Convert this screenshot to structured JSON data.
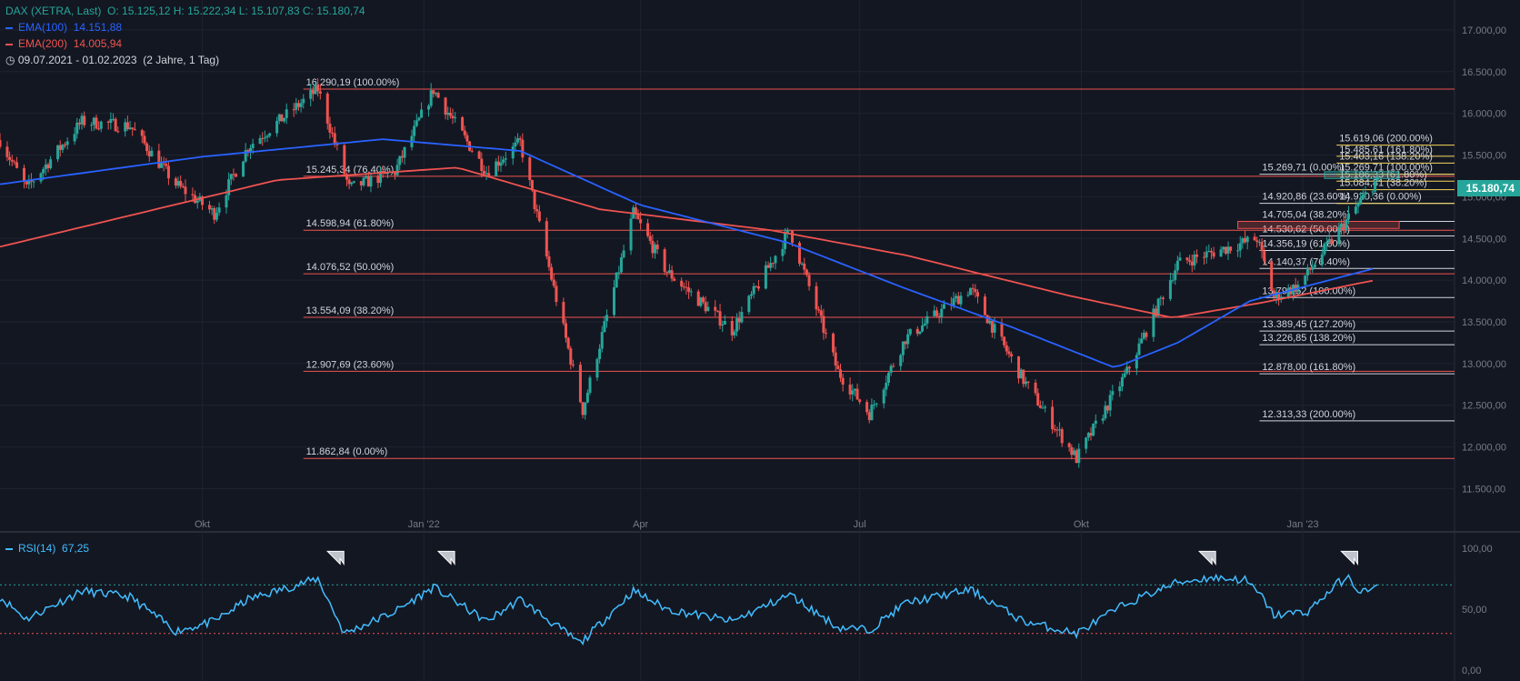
{
  "header": {
    "symbol": "DAX (XETRA, Last)",
    "ohlc": "O: 15.125,12  H: 15.222,34  L: 15.107,83  C: 15.180,74",
    "ema100_label": "EMA(100)",
    "ema100_value": "14.151,88",
    "ema200_label": "EMA(200)",
    "ema200_value": "14.005,94",
    "date_range": "09.07.2021 - 01.02.2023",
    "period": "(2 Jahre, 1 Tag)"
  },
  "last_price_label": "15.180,74",
  "rsi": {
    "label": "RSI(14)",
    "value": "67,25"
  },
  "colors": {
    "up": "#26a69a",
    "down": "#ef5350",
    "ema100": "#2962ff",
    "ema200": "#ef5350",
    "rsi": "#42bdff",
    "bg": "#131722"
  },
  "chart_data": {
    "type": "candlestick",
    "y_axis": {
      "min": 11200,
      "max": 17250,
      "ticks": [
        "11.500,00",
        "12.000,00",
        "12.500,00",
        "13.000,00",
        "13.500,00",
        "14.000,00",
        "14.500,00",
        "15.000,00",
        "15.500,00",
        "16.000,00",
        "16.500,00",
        "17.000,00"
      ],
      "tick_values": [
        11500,
        12000,
        12500,
        13000,
        13500,
        14000,
        14500,
        15000,
        15500,
        16000,
        16500,
        17000
      ]
    },
    "x_axis": {
      "labels": [
        "Okt",
        "Jan '22",
        "Apr",
        "Jul",
        "Okt",
        "Jan '23"
      ],
      "dates": [
        "2021-10-01",
        "2022-01-01",
        "2022-04-01",
        "2022-07-01",
        "2022-10-01",
        "2023-01-01"
      ]
    },
    "grid": true,
    "price_anchors": [
      [
        "2021-07-09",
        15680
      ],
      [
        "2021-07-20",
        15100
      ],
      [
        "2021-08-12",
        15900
      ],
      [
        "2021-09-01",
        15850
      ],
      [
        "2021-09-20",
        15150
      ],
      [
        "2021-10-06",
        14800
      ],
      [
        "2021-10-20",
        15600
      ],
      [
        "2021-11-18",
        16290
      ],
      [
        "2021-12-01",
        15100
      ],
      [
        "2021-12-20",
        15300
      ],
      [
        "2022-01-05",
        16280
      ],
      [
        "2022-01-27",
        15300
      ],
      [
        "2022-02-10",
        15650
      ],
      [
        "2022-02-24",
        13900
      ],
      [
        "2022-03-08",
        12440
      ],
      [
        "2022-03-29",
        14800
      ],
      [
        "2022-04-12",
        14100
      ],
      [
        "2022-05-09",
        13400
      ],
      [
        "2022-06-02",
        14600
      ],
      [
        "2022-06-22",
        12900
      ],
      [
        "2022-07-05",
        12400
      ],
      [
        "2022-07-20",
        13300
      ],
      [
        "2022-08-16",
        13900
      ],
      [
        "2022-09-07",
        12800
      ],
      [
        "2022-09-29",
        11862
      ],
      [
        "2022-10-20",
        12900
      ],
      [
        "2022-11-10",
        14200
      ],
      [
        "2022-12-13",
        14500
      ],
      [
        "2022-12-20",
        13800
      ],
      [
        "2022-12-30",
        13930
      ],
      [
        "2023-01-31",
        15180
      ],
      [
        "2023-02-01",
        15180
      ]
    ],
    "ema100_anchors": [
      [
        "2021-07-09",
        15150
      ],
      [
        "2021-10-01",
        15480
      ],
      [
        "2021-12-15",
        15690
      ],
      [
        "2022-02-10",
        15550
      ],
      [
        "2022-04-01",
        14900
      ],
      [
        "2022-06-01",
        14450
      ],
      [
        "2022-07-20",
        13900
      ],
      [
        "2022-09-01",
        13450
      ],
      [
        "2022-10-15",
        12950
      ],
      [
        "2022-11-10",
        13250
      ],
      [
        "2022-12-10",
        13750
      ],
      [
        "2023-02-01",
        14151.88
      ]
    ],
    "ema200_anchors": [
      [
        "2021-07-09",
        14400
      ],
      [
        "2021-11-01",
        15200
      ],
      [
        "2022-01-15",
        15350
      ],
      [
        "2022-03-15",
        14850
      ],
      [
        "2022-05-25",
        14600
      ],
      [
        "2022-07-20",
        14300
      ],
      [
        "2022-09-25",
        13820
      ],
      [
        "2022-11-08",
        13550
      ],
      [
        "2022-12-15",
        13730
      ],
      [
        "2023-02-01",
        14005.94
      ]
    ],
    "fib_left": [
      {
        "value": 16290.19,
        "label": "16.290,19 (100.00%)"
      },
      {
        "value": 15245.34,
        "label": "15.245,34 (76.40%)"
      },
      {
        "value": 14598.94,
        "label": "14.598,94 (61.80%)"
      },
      {
        "value": 14076.52,
        "label": "14.076,52 (50.00%)"
      },
      {
        "value": 13554.09,
        "label": "13.554,09 (38.20%)"
      },
      {
        "value": 12907.69,
        "label": "12.907,69 (23.60%)"
      },
      {
        "value": 11862.84,
        "label": "11.862,84 (0.00%)"
      }
    ],
    "fib_mid": [
      {
        "value": 15269.71,
        "label": "15.269,71 (0.00%)"
      },
      {
        "value": 14920.86,
        "label": "14.920,86 (23.60%)"
      },
      {
        "value": 14705.04,
        "label": "14.705,04 (38.20%)"
      },
      {
        "value": 14530.62,
        "label": "14.530,62 (50.00%)"
      },
      {
        "value": 14356.19,
        "label": "14.356,19 (61.80%)"
      },
      {
        "value": 14140.37,
        "label": "14.140,37 (76.40%)"
      },
      {
        "value": 13791.52,
        "label": "13.791,52 (100.00%)"
      },
      {
        "value": 13389.45,
        "label": "13.389,45 (127.20%)"
      },
      {
        "value": 13226.85,
        "label": "13.226,85 (138.20%)"
      },
      {
        "value": 12878.0,
        "label": "12.878,00 (161.80%)"
      },
      {
        "value": 12313.33,
        "label": "12.313,33 (200.00%)"
      }
    ],
    "fib_right": [
      {
        "value": 15619.06,
        "label": "15.619,06 (200.00%)"
      },
      {
        "value": 15485.61,
        "label": "15.485,61 (161.80%)"
      },
      {
        "value": 15403.16,
        "label": "15.403,16 (138.20%)"
      },
      {
        "value": 15269.71,
        "label": "15.269,71 (100.00%)"
      },
      {
        "value": 15186.33,
        "label": "15.186,33 (61.80%)"
      },
      {
        "value": 15084.81,
        "label": "15.084,81 (38.20%)"
      },
      {
        "value": 14920.36,
        "label": "14.920,36 (0.00%)"
      }
    ],
    "zones": [
      {
        "from": 15220,
        "to": 15300,
        "start": "2023-01-10",
        "end": "2023-02-10",
        "color": "#26a69a"
      },
      {
        "from": 14620,
        "to": 14705,
        "start": "2022-12-05",
        "end": "2023-02-10",
        "color": "#ef5350"
      }
    ],
    "rsi": {
      "min": 0,
      "max": 100,
      "ticks": [
        "0,00",
        "50,00",
        "100,00"
      ],
      "tick_values": [
        0,
        50,
        100
      ],
      "overbought": 70,
      "oversold": 30,
      "anchors": [
        [
          "2021-07-09",
          60
        ],
        [
          "2021-07-20",
          42
        ],
        [
          "2021-08-12",
          65
        ],
        [
          "2021-09-01",
          60
        ],
        [
          "2021-09-20",
          32
        ],
        [
          "2021-10-06",
          40
        ],
        [
          "2021-10-20",
          58
        ],
        [
          "2021-11-18",
          75
        ],
        [
          "2021-11-29",
          30
        ],
        [
          "2021-12-20",
          48
        ],
        [
          "2022-01-05",
          68
        ],
        [
          "2022-01-27",
          40
        ],
        [
          "2022-02-10",
          58
        ],
        [
          "2022-03-07",
          22
        ],
        [
          "2022-03-29",
          65
        ],
        [
          "2022-04-12",
          50
        ],
        [
          "2022-05-09",
          40
        ],
        [
          "2022-06-02",
          62
        ],
        [
          "2022-06-22",
          35
        ],
        [
          "2022-07-05",
          33
        ],
        [
          "2022-07-20",
          55
        ],
        [
          "2022-08-16",
          66
        ],
        [
          "2022-09-07",
          40
        ],
        [
          "2022-09-29",
          30
        ],
        [
          "2022-10-20",
          55
        ],
        [
          "2022-11-10",
          72
        ],
        [
          "2022-11-24",
          76
        ],
        [
          "2022-12-08",
          74
        ],
        [
          "2022-12-15",
          60
        ],
        [
          "2022-12-20",
          45
        ],
        [
          "2023-01-03",
          48
        ],
        [
          "2023-01-16",
          72
        ],
        [
          "2023-01-20",
          75
        ],
        [
          "2023-01-25",
          64
        ],
        [
          "2023-02-01",
          67.25
        ]
      ]
    },
    "rsi_arrows": [
      "2021-11-25",
      "2022-01-10",
      "2022-11-22",
      "2023-01-20"
    ]
  }
}
